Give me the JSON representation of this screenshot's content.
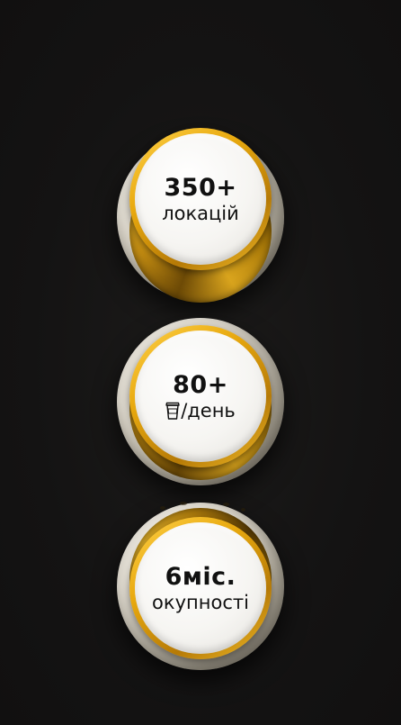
{
  "stats": [
    {
      "value": "350+",
      "label": "локацій"
    },
    {
      "value": "80+",
      "label": "/день",
      "icon": "coffee-cup-icon"
    },
    {
      "value": "6міс.",
      "label": "окупності"
    }
  ],
  "colors": {
    "background": "#151414",
    "gold": "#e6b42a",
    "lid": "#f6f5f2",
    "text": "#111111"
  }
}
